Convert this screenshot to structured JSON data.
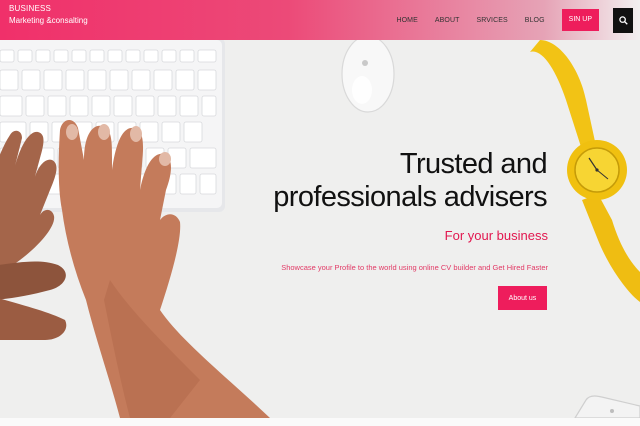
{
  "brand": {
    "name": "BUSINESS",
    "tagline": "Marketing &consalting"
  },
  "nav": {
    "links": [
      "HOME",
      "ABOUT",
      "SRVICES",
      "BLOG"
    ],
    "cta": "SIN UP",
    "search_icon": "search-icon"
  },
  "hero": {
    "headline_line1": "Trusted and",
    "headline_line2": "professionals advisers",
    "subheading": "For your business",
    "description": "Showcase your Profile to the world using online CV builder and Get Hired Faster",
    "button": "About us"
  },
  "colors": {
    "accent": "#ee1d5c",
    "text_dark": "#111111",
    "hero_bg": "#efefee"
  }
}
